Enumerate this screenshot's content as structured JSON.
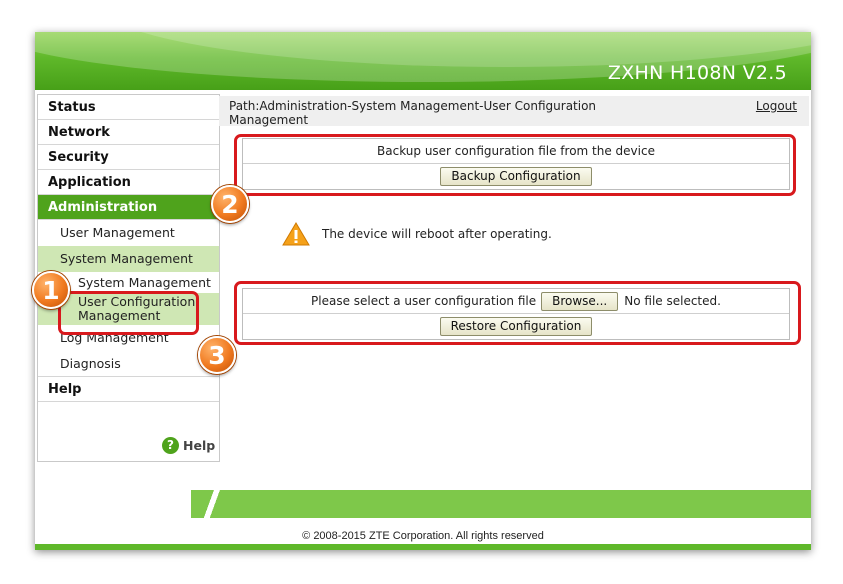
{
  "header": {
    "title": "ZXHN H108N V2.5"
  },
  "sidebar": {
    "items": [
      {
        "label": "Status"
      },
      {
        "label": "Network"
      },
      {
        "label": "Security"
      },
      {
        "label": "Application"
      },
      {
        "label": "Administration"
      }
    ],
    "admin_sub": [
      {
        "label": "User Management"
      },
      {
        "label": "System Management"
      },
      {
        "label": "System Management"
      },
      {
        "label": "User Configuration Management"
      },
      {
        "label": "Log Management"
      },
      {
        "label": "Diagnosis"
      }
    ],
    "help_item": "Help",
    "help_icon_glyph": "?",
    "help_link": "Help"
  },
  "pathbar": {
    "path": "Path:Administration-System Management-User Configuration Management",
    "logout": "Logout"
  },
  "backup": {
    "text": "Backup user configuration file from the device",
    "button": "Backup Configuration"
  },
  "warning": {
    "text": "The device will reboot after operating."
  },
  "restore": {
    "label": "Please select a user configuration file",
    "browse": "Browse...",
    "file_status": "No file selected.",
    "button": "Restore Configuration"
  },
  "footer": {
    "copyright": "© 2008-2015 ZTE Corporation. All rights reserved"
  },
  "callouts": [
    {
      "number": "1"
    },
    {
      "number": "2"
    },
    {
      "number": "3"
    }
  ],
  "colors": {
    "brand_green": "#4fa31c",
    "callout_red": "#d8191d",
    "badge_orange": "#f07a20",
    "warning_orange": "#f5a11a"
  }
}
